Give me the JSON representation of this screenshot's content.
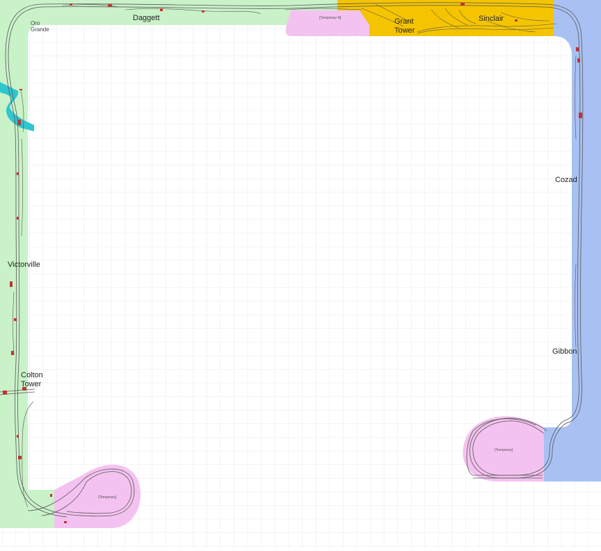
{
  "colors": {
    "green_region": "#c9f2c9",
    "yellow_region": "#f5c400",
    "blue_region": "#a9c1f2",
    "pink_region": "#f4c2f0",
    "river": "#2ec6cf",
    "grid": "#e3e3e3",
    "track": "#555555",
    "signal": "#c33333"
  },
  "labels": {
    "daggett": "Daggett",
    "oro_grande_1": "Oro",
    "oro_grande_2": "Grande",
    "temporary_n": "[Temporary N]",
    "grant_tower_1": "Grant",
    "grant_tower_2": "Tower",
    "sinclair": "Sinclair",
    "cozad": "Cozad",
    "victorville": "Victorville",
    "gibbon": "Gibbon",
    "colton_tower_1": "Colton",
    "colton_tower_2": "Tower",
    "temporary_se": "[Temporary]",
    "temporary_sw": "[Temporary]"
  }
}
